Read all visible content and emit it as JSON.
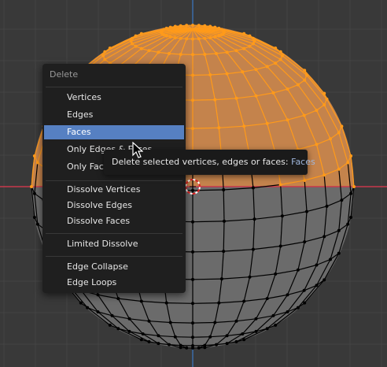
{
  "menu": {
    "title": "Delete",
    "items": [
      {
        "label": "Vertices",
        "active": false
      },
      {
        "label": "Edges",
        "active": false
      },
      {
        "label": "Faces",
        "active": true
      },
      {
        "label": "Only Edges & Faces",
        "active": false
      },
      {
        "label": "Only Faces",
        "active": false
      },
      {
        "label": "Dissolve Vertices",
        "active": false
      },
      {
        "label": "Dissolve Edges",
        "active": false
      },
      {
        "label": "Dissolve Faces",
        "active": false
      },
      {
        "label": "Limited Dissolve",
        "active": false
      },
      {
        "label": "Edge Collapse",
        "active": false
      },
      {
        "label": "Edge Loops",
        "active": false
      }
    ]
  },
  "tooltip": {
    "text": "Delete selected vertices, edges or faces:",
    "value": "Faces"
  },
  "colors": {
    "background": "#393939",
    "selected_face": "#c4834c",
    "selected_edge": "#ff9a1a",
    "unselected_face": "#6b6b6b",
    "unselected_edge": "#000000",
    "x_axis": "#c8384c",
    "y_axis": "#3a6ca8",
    "menu_highlight": "#5680c2"
  },
  "icons": {
    "cursor": "mouse-pointer-icon",
    "origin": "3d-cursor-icon"
  }
}
